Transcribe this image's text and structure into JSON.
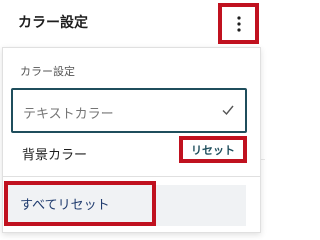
{
  "panel": {
    "title": "カラー設定"
  },
  "icons": {
    "options": "vertical-ellipsis",
    "check": "checkmark"
  },
  "menu": {
    "group_label": "カラー設定",
    "items": [
      {
        "label": "テキストカラー",
        "selected": true
      },
      {
        "label": "背景カラー",
        "action_label": "リセット"
      }
    ],
    "reset_all_label": "すべてリセット"
  },
  "colors": {
    "highlight": "#c0111f",
    "accent": "#1f4e5c"
  }
}
